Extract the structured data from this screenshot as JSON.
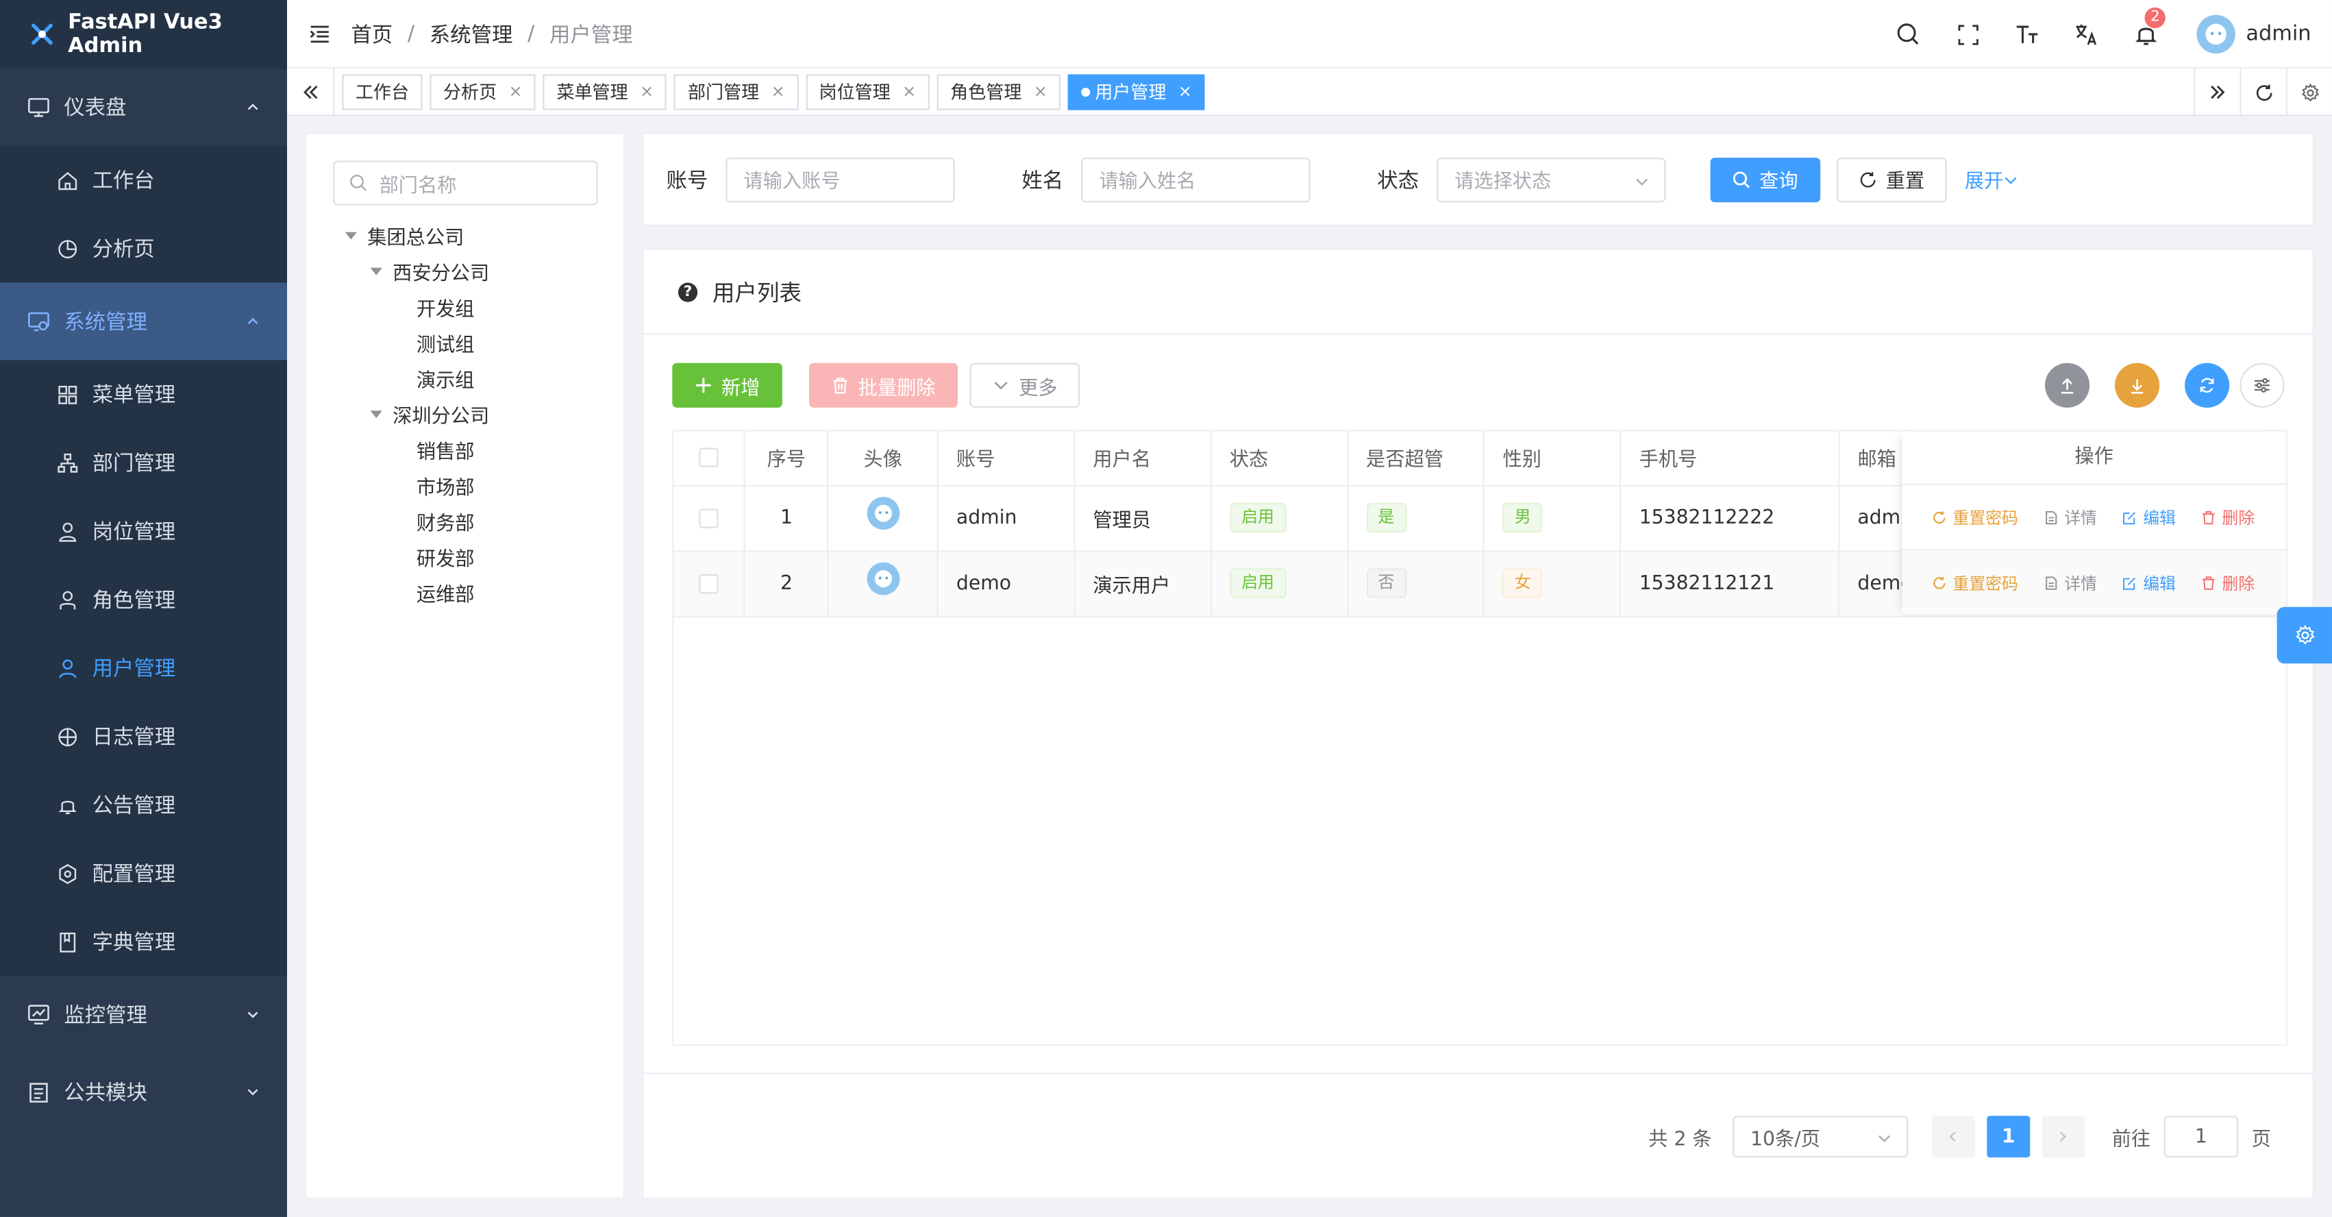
{
  "app": {
    "title": "FastAPI Vue3 Admin"
  },
  "sidebar": {
    "groups": [
      {
        "label": "仪表盘",
        "items": [
          {
            "label": "工作台"
          },
          {
            "label": "分析页"
          }
        ]
      },
      {
        "label": "系统管理",
        "items": [
          {
            "label": "菜单管理"
          },
          {
            "label": "部门管理"
          },
          {
            "label": "岗位管理"
          },
          {
            "label": "角色管理"
          },
          {
            "label": "用户管理"
          },
          {
            "label": "日志管理"
          },
          {
            "label": "公告管理"
          },
          {
            "label": "配置管理"
          },
          {
            "label": "字典管理"
          }
        ]
      },
      {
        "label": "监控管理"
      },
      {
        "label": "公共模块"
      }
    ]
  },
  "header": {
    "breadcrumb": [
      "首页",
      "系统管理",
      "用户管理"
    ],
    "separator": "/",
    "notification_count": "2",
    "username": "admin"
  },
  "tabs": {
    "items": [
      "工作台",
      "分析页",
      "菜单管理",
      "部门管理",
      "岗位管理",
      "角色管理",
      "用户管理"
    ],
    "close": "×"
  },
  "tree": {
    "search_placeholder": "部门名称",
    "root": "集团总公司",
    "branches": [
      {
        "label": "西安分公司",
        "children": [
          "开发组",
          "测试组",
          "演示组"
        ]
      },
      {
        "label": "深圳分公司",
        "children": [
          "销售部",
          "市场部",
          "财务部",
          "研发部",
          "运维部"
        ]
      }
    ]
  },
  "search": {
    "account_label": "账号",
    "account_placeholder": "请输入账号",
    "name_label": "姓名",
    "name_placeholder": "请输入姓名",
    "status_label": "状态",
    "status_placeholder": "请选择状态",
    "query": "查询",
    "reset": "重置",
    "expand": "展开"
  },
  "card": {
    "title": "用户列表",
    "help": "?"
  },
  "toolbar": {
    "add": "新增",
    "batch_delete": "批量删除",
    "more": "更多"
  },
  "table": {
    "headers": [
      "序号",
      "头像",
      "账号",
      "用户名",
      "状态",
      "是否超管",
      "性别",
      "手机号",
      "邮箱",
      "操作"
    ],
    "rows": [
      {
        "index": "1",
        "account": "admin",
        "username": "管理员",
        "status": "启用",
        "superuser": "是",
        "gender": "男",
        "phone": "15382112222",
        "email": "admin"
      },
      {
        "index": "2",
        "account": "demo",
        "username": "演示用户",
        "status": "启用",
        "superuser": "否",
        "gender": "女",
        "phone": "15382112121",
        "email": "demo"
      }
    ],
    "ops": {
      "reset_pwd": "重置密码",
      "detail": "详情",
      "edit": "编辑",
      "delete": "删除"
    }
  },
  "pagination": {
    "total": "共 2 条",
    "page_size": "10条/页",
    "current": "1",
    "goto_label": "前往",
    "goto_value": "1",
    "page_unit": "页"
  },
  "colors": {
    "primary": "#409eff",
    "success": "#67c23a",
    "warning": "#e6a23c",
    "danger": "#f56c6c",
    "sidebar": "#2b3a4f"
  }
}
